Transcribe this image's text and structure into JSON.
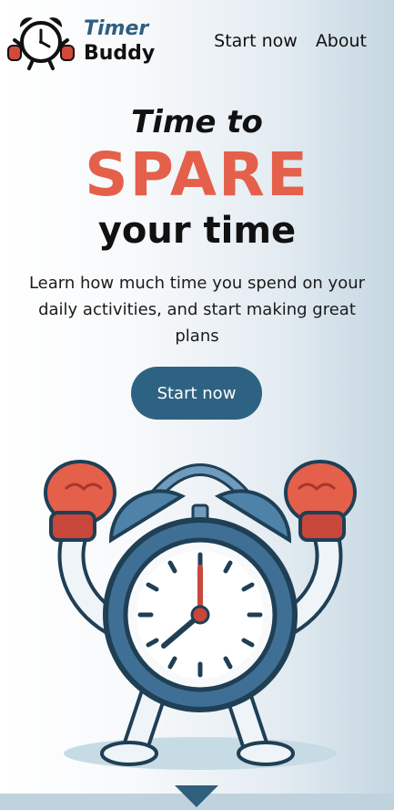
{
  "brand": {
    "line1": "Timer",
    "line2": "Buddy",
    "logo_icon": "boxing-clock-icon"
  },
  "nav": {
    "start_now": "Start now",
    "about": "About"
  },
  "hero": {
    "line1": "Time to",
    "line2": "SPARE",
    "line3": "your time",
    "description": "Learn how much time you spend on your daily activities, and start making great plans",
    "cta": "Start now"
  },
  "colors": {
    "accent": "#2e6282",
    "highlight": "#e4604b",
    "brand_blue": "#2f5f80"
  },
  "illustration": {
    "icon": "boxing-alarm-clock-icon"
  },
  "scroll_indicator": {
    "icon": "down-arrow-icon"
  }
}
